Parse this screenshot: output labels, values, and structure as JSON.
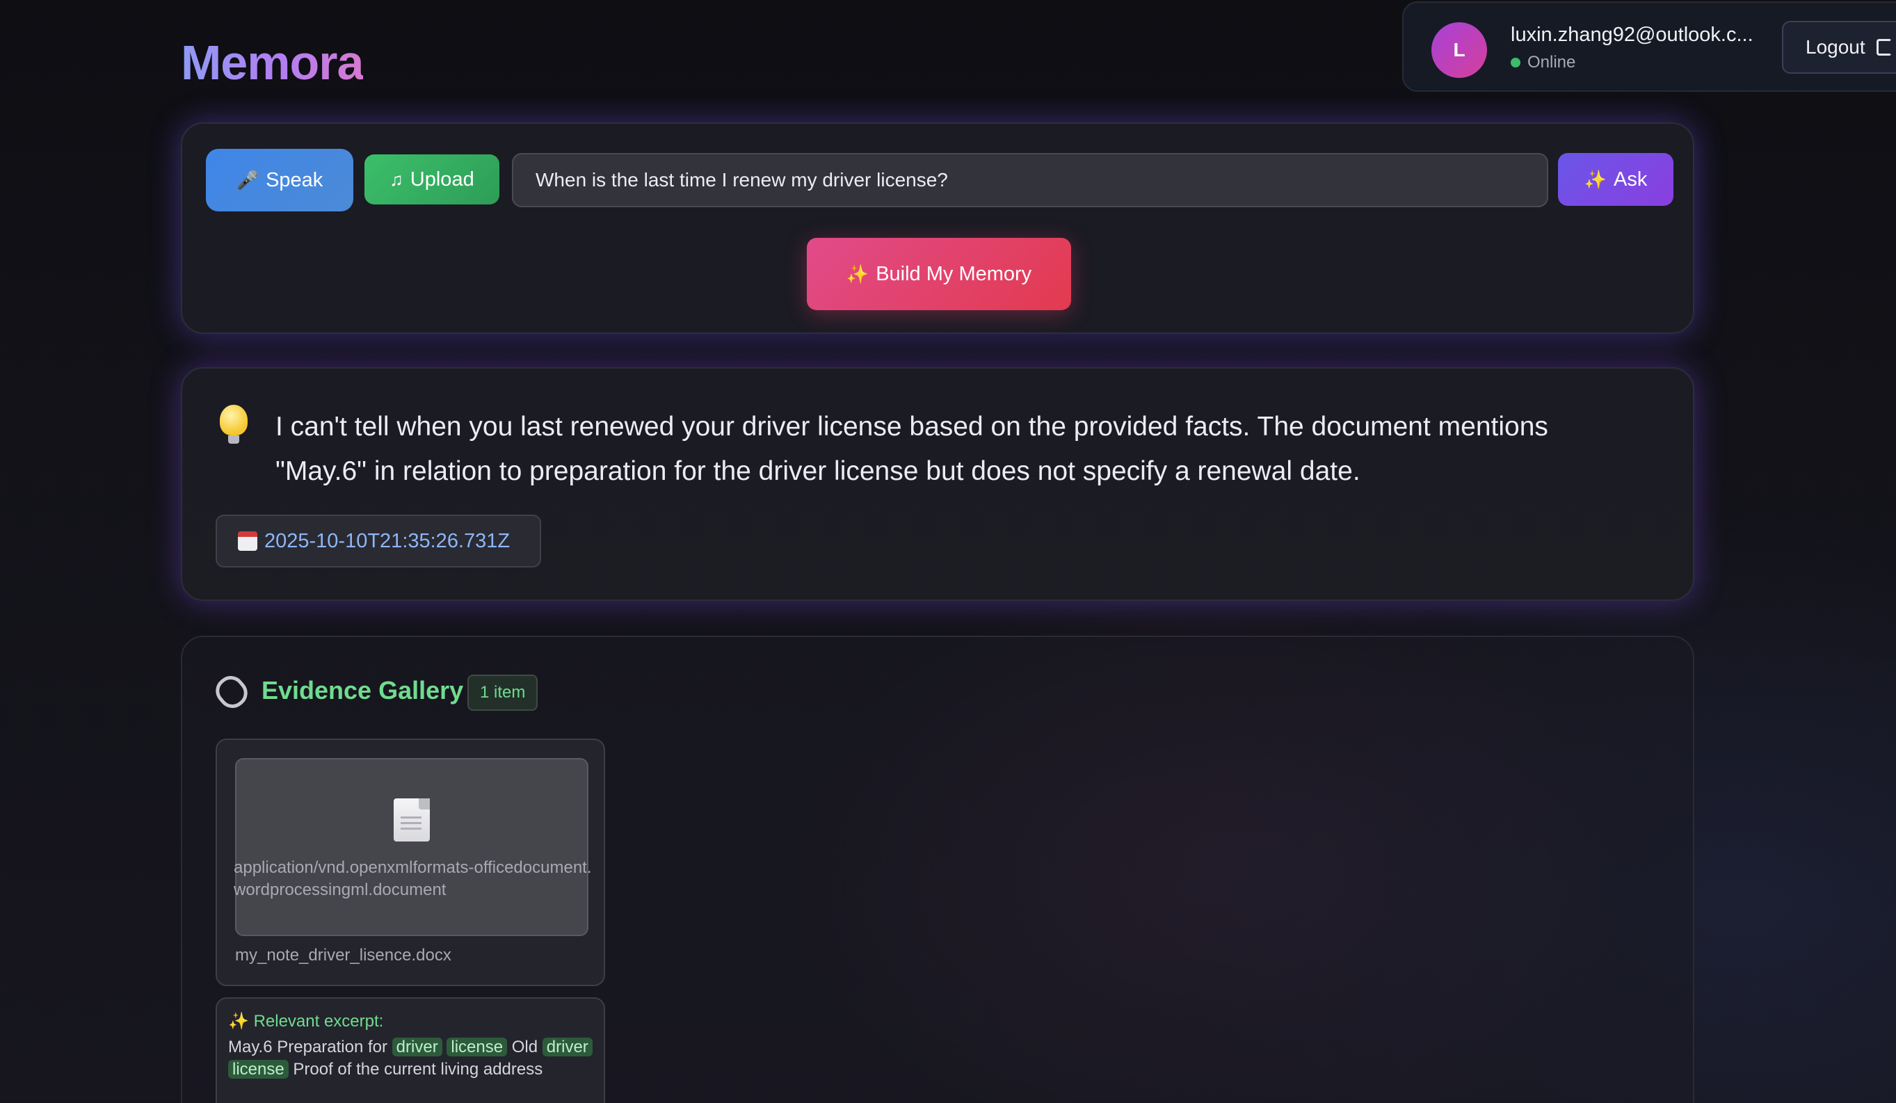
{
  "app": {
    "brand": "Memora"
  },
  "user": {
    "avatar_initial": "L",
    "email": "luxin.zhang92@outlook.c...",
    "status": "Online",
    "logout_label": "Logout"
  },
  "query": {
    "speak_label": "Speak",
    "upload_label": "Upload",
    "input_value": "When is the last time I renew my driver license?",
    "ask_label": "Ask",
    "build_label": "Build My Memory"
  },
  "answer": {
    "text": "I can't tell when you last renewed your driver license based on the provided facts. The document mentions \"May.6\" in relation to preparation for the driver license but does not specify a renewal date.",
    "timestamp": "2025-10-10T21:35:26.731Z"
  },
  "evidence": {
    "title": "Evidence Gallery",
    "count": "1 item",
    "items": [
      {
        "mime_type": "application/vnd.openxmlformats-officedocument.wordprocessingml.document",
        "filename": "my_note_driver_lisence.docx",
        "excerpt_title": "Relevant excerpt:",
        "excerpt_parts": [
          "May.6 Preparation for ",
          "driver",
          " ",
          "license",
          " Old ",
          "driver",
          " ",
          "license",
          " Proof of the current living address"
        ]
      }
    ]
  },
  "colors": {
    "accent_green": "#6fdc8e",
    "speak": "#3f86e8",
    "upload": "#3bbf6a",
    "ask": "#6a56e8",
    "build": "#e14b8a",
    "online": "#3dbb6a"
  },
  "icons": [
    "microphone-icon",
    "music-note-icon",
    "sparkle-icon",
    "lightbulb-icon",
    "calendar-icon",
    "paperclip-icon",
    "document-icon",
    "logout-icon"
  ]
}
